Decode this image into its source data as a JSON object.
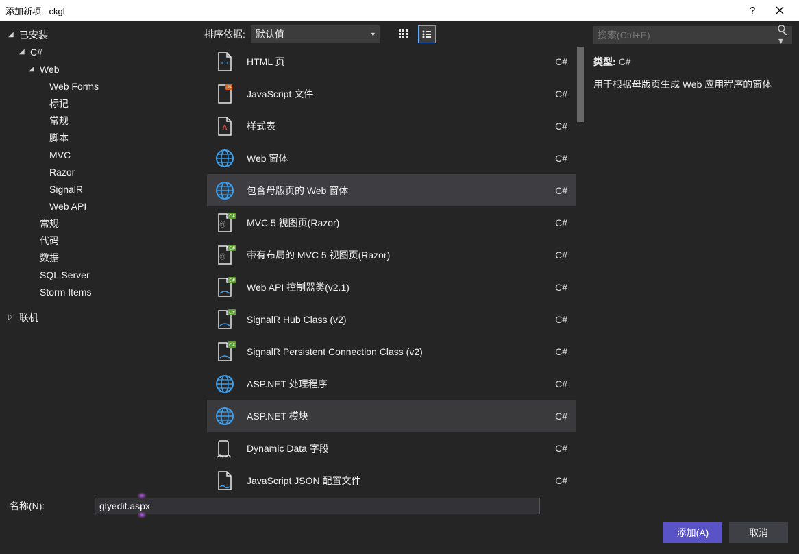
{
  "window": {
    "title": "添加新项 - ckgl"
  },
  "tree": {
    "installed": "已安装",
    "csharp": "C#",
    "web": "Web",
    "web_children": [
      "Web Forms",
      "标记",
      "常规",
      "脚本",
      "MVC",
      "Razor",
      "SignalR",
      "Web API"
    ],
    "csharp_siblings": [
      "常规",
      "代码",
      "数据",
      "SQL Server",
      "Storm Items"
    ],
    "online": "联机"
  },
  "sort": {
    "label": "排序依据:",
    "value": "默认值"
  },
  "search": {
    "placeholder": "搜索(Ctrl+E)"
  },
  "items": [
    {
      "name": "HTML 页",
      "lang": "C#",
      "icon": "html"
    },
    {
      "name": "JavaScript 文件",
      "lang": "C#",
      "icon": "js"
    },
    {
      "name": "样式表",
      "lang": "C#",
      "icon": "css"
    },
    {
      "name": "Web 窗体",
      "lang": "C#",
      "icon": "web"
    },
    {
      "name": "包含母版页的 Web 窗体",
      "lang": "C#",
      "icon": "web",
      "selected": true
    },
    {
      "name": "MVC 5 视图页(Razor)",
      "lang": "C#",
      "icon": "razor"
    },
    {
      "name": "带有布局的 MVC 5 视图页(Razor)",
      "lang": "C#",
      "icon": "razor"
    },
    {
      "name": "Web API 控制器类(v2.1)",
      "lang": "C#",
      "icon": "api"
    },
    {
      "name": "SignalR Hub Class (v2)",
      "lang": "C#",
      "icon": "api"
    },
    {
      "name": "SignalR Persistent Connection Class (v2)",
      "lang": "C#",
      "icon": "api"
    },
    {
      "name": "ASP.NET 处理程序",
      "lang": "C#",
      "icon": "web2"
    },
    {
      "name": "ASP.NET 模块",
      "lang": "C#",
      "icon": "web2",
      "hover": true
    },
    {
      "name": "Dynamic Data 字段",
      "lang": "C#",
      "icon": "dd"
    },
    {
      "name": "JavaScript JSON 配置文件",
      "lang": "C#",
      "icon": "json"
    }
  ],
  "detail": {
    "type_label": "类型:",
    "type_value": "C#",
    "description": "用于根据母版页生成 Web 应用程序的窗体"
  },
  "footer": {
    "name_label": "名称(N):",
    "name_value": "glyedit.aspx",
    "add": "添加(A)",
    "cancel": "取消"
  }
}
